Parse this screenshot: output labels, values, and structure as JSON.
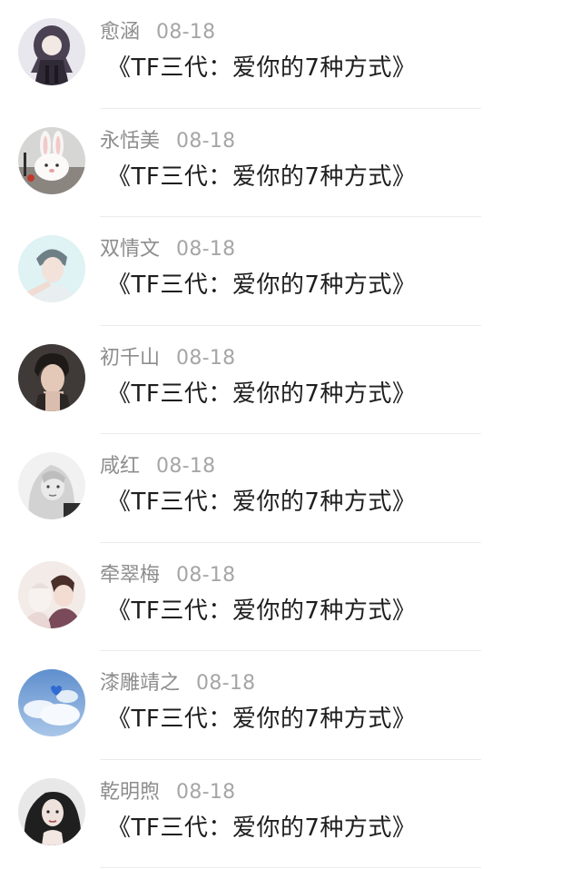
{
  "comments": [
    {
      "name": "愈涵",
      "date": "08-18",
      "text": "《TF三代：爱你的7种方式》",
      "avatar_icon": "anime-girl-avatar-icon",
      "avatar_color": "#6a6075"
    },
    {
      "name": "永恬美",
      "date": "08-18",
      "text": "《TF三代：爱你的7种方式》",
      "avatar_icon": "rabbit-plush-avatar-icon",
      "avatar_color": "#d9d9d9"
    },
    {
      "name": "双情文",
      "date": "08-18",
      "text": "《TF三代：爱你的7种方式》",
      "avatar_icon": "boy-portrait-avatar-icon",
      "avatar_color": "#c7e6ea"
    },
    {
      "name": "初千山",
      "date": "08-18",
      "text": "《TF三代：爱你的7种方式》",
      "avatar_icon": "man-portrait-avatar-icon",
      "avatar_color": "#4d4540"
    },
    {
      "name": "咸红",
      "date": "08-18",
      "text": "《TF三代：爱你的7种方式》",
      "avatar_icon": "woman-bw-avatar-icon",
      "avatar_color": "#9a9a9a"
    },
    {
      "name": "牵翠梅",
      "date": "08-18",
      "text": "《TF三代：爱你的7种方式》",
      "avatar_icon": "anime-couple-avatar-icon",
      "avatar_color": "#e7d6d6"
    },
    {
      "name": "漆雕靖之",
      "date": "08-18",
      "text": "《TF三代：爱你的7种方式》",
      "avatar_icon": "sky-clouds-avatar-icon",
      "avatar_color": "#7fa6d6"
    },
    {
      "name": "乾明煦",
      "date": "08-18",
      "text": "《TF三代：爱你的7种方式》",
      "avatar_icon": "curly-hair-girl-avatar-icon",
      "avatar_color": "#3a3a3a"
    }
  ]
}
